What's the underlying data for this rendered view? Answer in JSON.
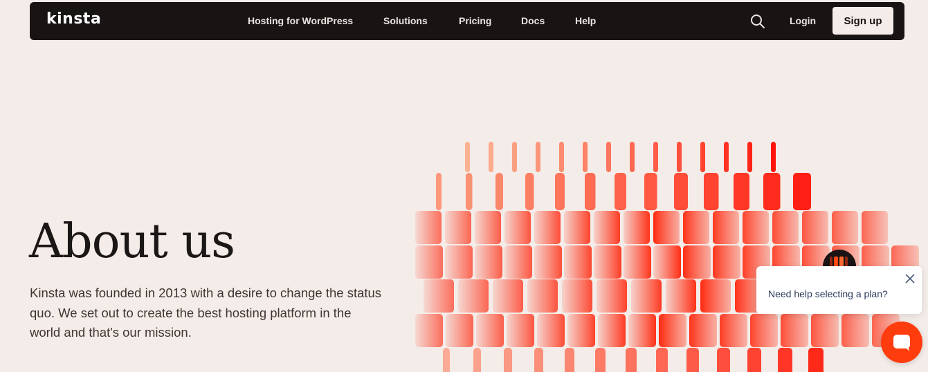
{
  "nav": {
    "logo": "kinsta",
    "items": [
      {
        "label": "Hosting for WordPress"
      },
      {
        "label": "Solutions"
      },
      {
        "label": "Pricing"
      },
      {
        "label": "Docs"
      },
      {
        "label": "Help"
      }
    ],
    "login": "Login",
    "signup": "Sign up"
  },
  "hero": {
    "title": "About us",
    "body": "Kinsta was founded in 2013 with a desire to change the status quo. We set out to create the best hosting platform in the world and that's our mission."
  },
  "chat": {
    "message": "Need help selecting a plan?"
  },
  "colors": {
    "nav_bg": "#181414",
    "page_bg": "#f4ece8",
    "accent": "#ff3c0e"
  },
  "icons": {
    "search": "search-icon",
    "close": "close-icon",
    "chat": "chat-bubble-icon"
  }
}
